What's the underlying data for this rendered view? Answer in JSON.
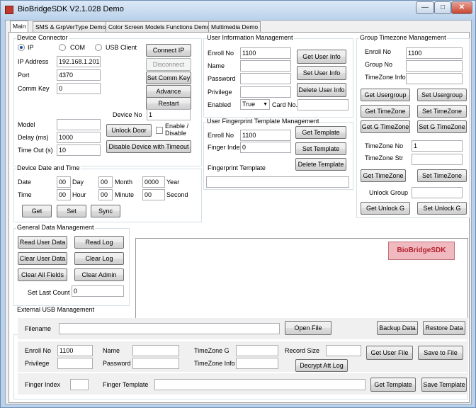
{
  "window": {
    "title": "BioBridgeSDK V2.1.028 Demo",
    "min": "—",
    "max": "□",
    "close": "✕"
  },
  "tabs": [
    "Main",
    "SMS & GrpVerType Demo",
    "Color Screen Models Functions Demo",
    "Multimedia Demo"
  ],
  "device_connector": {
    "legend": "Device Connector",
    "radio_ip": "IP",
    "radio_com": "COM",
    "radio_usb": "USB Client",
    "ip_label": "IP Address",
    "ip_value": "192.168.1.201",
    "port_label": "Port",
    "port_value": "4370",
    "commkey_label": "Comm Key",
    "commkey_value": "0",
    "btn_connect": "Connect IP",
    "btn_disconnect": "Disconnect",
    "btn_setcommkey": "Set Comm Key",
    "btn_advance": "Advance",
    "btn_restart": "Restart",
    "deviceno_label": "Device No",
    "deviceno_value": "1",
    "model_label": "Model",
    "model_value": "",
    "delay_label": "Delay (ms)",
    "delay_value": "1000",
    "timeout_label": "Time Out (s)",
    "timeout_value": "10",
    "btn_unlock": "Unlock Door",
    "enable_label": "Enable / Disable",
    "btn_disable_timeout": "Disable Device with Timeout"
  },
  "date_time": {
    "legend": "Device Date and Time",
    "date_label": "Date",
    "day_value": "00",
    "day_label": "Day",
    "month_value": "00",
    "month_label": "Month",
    "year_value": "0000",
    "year_label": "Year",
    "time_label": "Time",
    "hour_value": "00",
    "hour_label": "Hour",
    "minute_value": "00",
    "minute_label": "Minute",
    "second_value": "00",
    "second_label": "Second",
    "btn_get": "Get",
    "btn_set": "Set",
    "btn_sync": "Sync"
  },
  "user_info": {
    "legend": "User Information Management",
    "enroll_label": "Enroll No",
    "enroll_value": "1100",
    "name_label": "Name",
    "password_label": "Password",
    "privilege_label": "Privilege",
    "enabled_label": "Enabled",
    "enabled_value": "True",
    "cardno_label": "Card No.",
    "btn_get": "Get User Info",
    "btn_set": "Set User Info",
    "btn_delete": "Delete User Info"
  },
  "fingerprint": {
    "legend": "User Fingerprint Template Management",
    "enroll_label": "Enroll No",
    "enroll_value": "1100",
    "index_label": "Finger Index",
    "index_value": "0",
    "template_label": "Fingerprint Template",
    "btn_get": "Get Template",
    "btn_set": "Set Template",
    "btn_delete": "Delete Template"
  },
  "group_tz": {
    "legend": "Group Timezone Management",
    "enroll_label": "Enroll No",
    "enroll_value": "1100",
    "groupno_label": "Group No",
    "tzinfo_label": "TimeZone Info",
    "btn_get_usergroup": "Get Usergroup",
    "btn_set_usergroup": "Set Usergroup",
    "btn_get_tz": "Get TimeZone",
    "btn_set_tz": "Set TimeZone",
    "btn_get_gtz": "Get G TimeZone",
    "btn_set_gtz": "Set G TimeZone",
    "tzno_label": "TimeZone No",
    "tzno_value": "1",
    "tzstr_label": "TimeZone Str",
    "btn_get_tz2": "Get TimeZone",
    "btn_set_tz2": "Set TimeZone",
    "unlockgroup_label": "Unlock Group",
    "btn_get_unlock": "Get Unlock G",
    "btn_set_unlock": "Set Unlock G"
  },
  "general": {
    "legend": "General Data Management",
    "btn_read_user": "Read User Data",
    "btn_read_log": "Read Log",
    "btn_clear_user": "Clear User Data",
    "btn_clear_log": "Clear Log",
    "btn_clear_all": "Clear All Fields",
    "btn_clear_admin": "Clear Admin",
    "lastcount_label": "Set Last Count",
    "lastcount_value": "0"
  },
  "brand": "BioBridgeSDK",
  "usb": {
    "legend": "External USB Management",
    "filename_label": "Filename",
    "btn_open": "Open File",
    "btn_backup": "Backup Data",
    "btn_restore": "Restore Data",
    "enroll_label": "Enroll No",
    "enroll_value": "1100",
    "name_label": "Name",
    "tzg_label": "TimeZone G",
    "recsize_label": "Record Size",
    "btn_get_userfile": "Get User File",
    "btn_savefile": "Save to File",
    "privilege_label": "Privilege",
    "password_label": "Password",
    "tzinfo_label": "TimeZone Info",
    "btn_decrypt": "Decrypt Att Log",
    "fingerindex_label": "Finger Index",
    "fingertemplate_label": "Finger Template",
    "btn_get_template": "Get Template",
    "btn_save_template": "Save Template"
  }
}
